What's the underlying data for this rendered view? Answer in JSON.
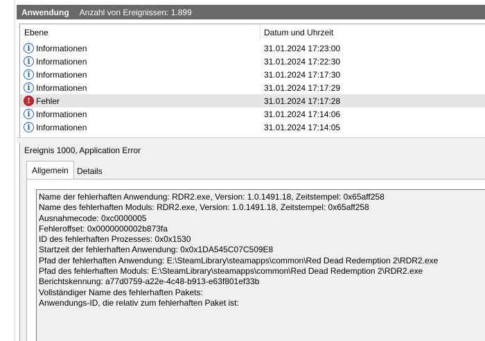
{
  "header": {
    "title": "Anwendung",
    "count_text": "Anzahl von Ereignissen: 1.899"
  },
  "columns": {
    "level": "Ebene",
    "datetime": "Datum und Uhrzeit"
  },
  "rows": [
    {
      "icon": "info-icon",
      "glyph": "i",
      "level": "Informationen",
      "datetime": "31.01.2024 17:23:00"
    },
    {
      "icon": "info-icon",
      "glyph": "i",
      "level": "Informationen",
      "datetime": "31.01.2024 17:22:30"
    },
    {
      "icon": "info-icon",
      "glyph": "i",
      "level": "Informationen",
      "datetime": "31.01.2024 17:17:30"
    },
    {
      "icon": "info-icon",
      "glyph": "i",
      "level": "Informationen",
      "datetime": "31.01.2024 17:17:29"
    },
    {
      "icon": "error-icon",
      "glyph": "!",
      "level": "Fehler",
      "datetime": "31.01.2024 17:17:28"
    },
    {
      "icon": "info-icon",
      "glyph": "i",
      "level": "Informationen",
      "datetime": "31.01.2024 17:14:06"
    },
    {
      "icon": "info-icon",
      "glyph": "i",
      "level": "Informationen",
      "datetime": "31.01.2024 17:14:05"
    }
  ],
  "detail": {
    "title": "Ereignis 1000, Application Error",
    "tabs": [
      "Allgemein",
      "Details"
    ],
    "lines": [
      "Name der fehlerhaften Anwendung: RDR2.exe, Version: 1.0.1491.18, Zeitstempel: 0x65aff258",
      "Name des fehlerhaften Moduls: RDR2.exe, Version: 1.0.1491.18, Zeitstempel: 0x65aff258",
      "Ausnahmecode: 0xc0000005",
      "Fehleroffset: 0x0000000002b873fa",
      "ID des fehlerhaften Prozesses: 0x0x1530",
      "Startzeit der fehlerhaften Anwendung: 0x0x1DA545C07C509E8",
      "Pfad der fehlerhaften Anwendung: E:\\SteamLibrary\\steamapps\\common\\Red Dead Redemption 2\\RDR2.exe",
      "Pfad des fehlerhaften Moduls: E:\\SteamLibrary\\steamapps\\common\\Red Dead Redemption 2\\RDR2.exe",
      "Berichtskennung: a77d0759-a22e-4c48-b913-e63f801ef33b",
      "Vollständiger Name des fehlerhaften Pakets:",
      "Anwendungs-ID, die relativ zum fehlerhaften Paket ist:"
    ]
  },
  "colors": {
    "header_bg": "#696969",
    "selected_row": "#e5e5e5",
    "info_blue": "#1f5fb8",
    "error_red": "#c4262e"
  }
}
